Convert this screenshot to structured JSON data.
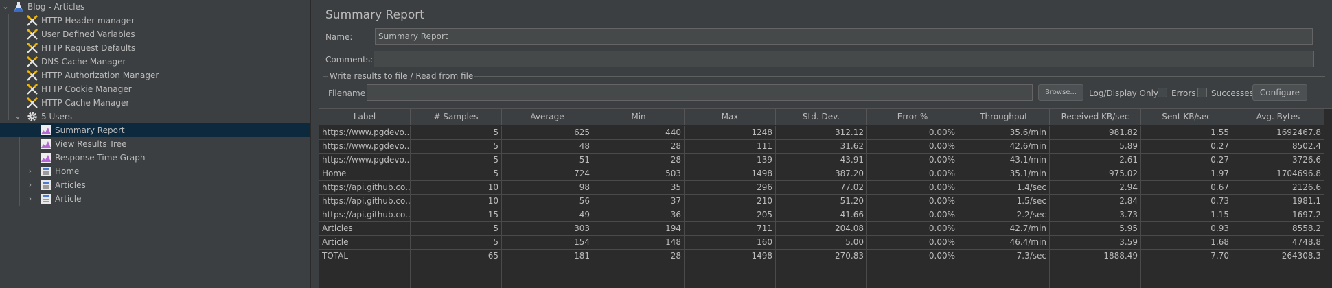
{
  "tree": {
    "items": [
      {
        "label": "Blog - Articles",
        "icon": "flask-icon"
      },
      {
        "label": "HTTP Header manager",
        "icon": "config-element-icon"
      },
      {
        "label": "User Defined Variables",
        "icon": "config-element-icon"
      },
      {
        "label": "HTTP Request Defaults",
        "icon": "config-element-icon"
      },
      {
        "label": "DNS Cache Manager",
        "icon": "config-element-icon"
      },
      {
        "label": "HTTP Authorization Manager",
        "icon": "config-element-icon"
      },
      {
        "label": "HTTP Cookie Manager",
        "icon": "config-element-icon"
      },
      {
        "label": "HTTP Cache Manager",
        "icon": "config-element-icon"
      },
      {
        "label": "5 Users",
        "icon": "gear-icon"
      },
      {
        "label": "Summary Report",
        "icon": "listener-icon"
      },
      {
        "label": "View Results Tree",
        "icon": "listener-icon"
      },
      {
        "label": "Response Time Graph",
        "icon": "listener-icon"
      },
      {
        "label": "Home",
        "icon": "controller-icon"
      },
      {
        "label": "Articles",
        "icon": "controller-icon"
      },
      {
        "label": "Article",
        "icon": "controller-icon"
      }
    ]
  },
  "panel": {
    "title": "Summary Report",
    "name_label": "Name:",
    "name_value": "Summary Report",
    "comments_label": "Comments:",
    "comments_value": "",
    "file_group_title": "Write results to file / Read from file",
    "filename_label": "Filename",
    "filename_value": "",
    "browse_label": "Browse...",
    "log_display_label": "Log/Display Only:",
    "errors_label": "Errors",
    "successes_label": "Successes",
    "configure_label": "Configure"
  },
  "table": {
    "headers": [
      "Label",
      "# Samples",
      "Average",
      "Min",
      "Max",
      "Std. Dev.",
      "Error %",
      "Throughput",
      "Received KB/sec",
      "Sent KB/sec",
      "Avg. Bytes"
    ],
    "rows": [
      [
        "https://www.pgdevo...",
        "5",
        "625",
        "440",
        "1248",
        "312.12",
        "0.00%",
        "35.6/min",
        "981.82",
        "1.55",
        "1692467.8"
      ],
      [
        "https://www.pgdevo...",
        "5",
        "48",
        "28",
        "111",
        "31.62",
        "0.00%",
        "42.6/min",
        "5.89",
        "0.27",
        "8502.4"
      ],
      [
        "https://www.pgdevo...",
        "5",
        "51",
        "28",
        "139",
        "43.91",
        "0.00%",
        "43.1/min",
        "2.61",
        "0.27",
        "3726.6"
      ],
      [
        "Home",
        "5",
        "724",
        "503",
        "1498",
        "387.20",
        "0.00%",
        "35.1/min",
        "975.02",
        "1.97",
        "1704696.8"
      ],
      [
        "https://api.github.co...",
        "10",
        "98",
        "35",
        "296",
        "77.02",
        "0.00%",
        "1.4/sec",
        "2.94",
        "0.67",
        "2126.6"
      ],
      [
        "https://api.github.co...",
        "10",
        "56",
        "37",
        "210",
        "51.20",
        "0.00%",
        "1.5/sec",
        "2.84",
        "0.73",
        "1981.1"
      ],
      [
        "https://api.github.co...",
        "15",
        "49",
        "36",
        "205",
        "41.66",
        "0.00%",
        "2.2/sec",
        "3.73",
        "1.15",
        "1697.2"
      ],
      [
        "Articles",
        "5",
        "303",
        "194",
        "711",
        "204.08",
        "0.00%",
        "42.7/min",
        "5.95",
        "0.93",
        "8558.2"
      ],
      [
        "Article",
        "5",
        "154",
        "148",
        "160",
        "5.00",
        "0.00%",
        "46.4/min",
        "3.59",
        "1.68",
        "4748.8"
      ],
      [
        "TOTAL",
        "65",
        "181",
        "28",
        "1498",
        "270.83",
        "0.00%",
        "7.3/sec",
        "1888.49",
        "7.70",
        "264308.3"
      ]
    ]
  }
}
